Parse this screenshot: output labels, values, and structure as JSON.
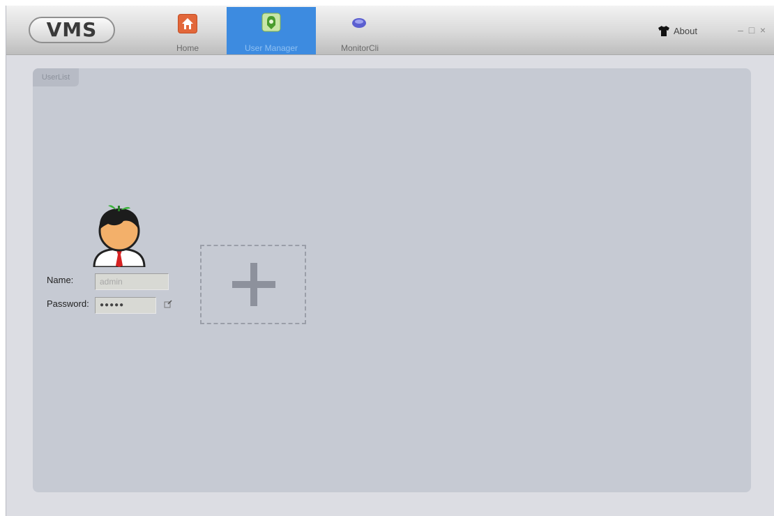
{
  "app": {
    "logo_text": "VMS"
  },
  "nav": {
    "tabs": [
      {
        "label": "Home",
        "icon": "home-icon"
      },
      {
        "label": "User Manager",
        "icon": "user-manager-icon",
        "active": true
      },
      {
        "label": "MonitorCli",
        "icon": "monitor-icon"
      }
    ]
  },
  "header": {
    "about_label": "About",
    "about_icon": "shirt-icon",
    "window_controls": {
      "minimize": "–",
      "maximize": "□",
      "close": "×"
    }
  },
  "panel": {
    "group_tab_label": "UserList",
    "user_card": {
      "name_label": "Name:",
      "name_value": "admin",
      "password_label": "Password:",
      "password_value": "●●●●●"
    },
    "add_user_icon": "plus-icon"
  },
  "colors": {
    "active_tab": "#3d8be0",
    "panel_bg": "#c6cad3",
    "window_bg": "#dcdde3"
  }
}
